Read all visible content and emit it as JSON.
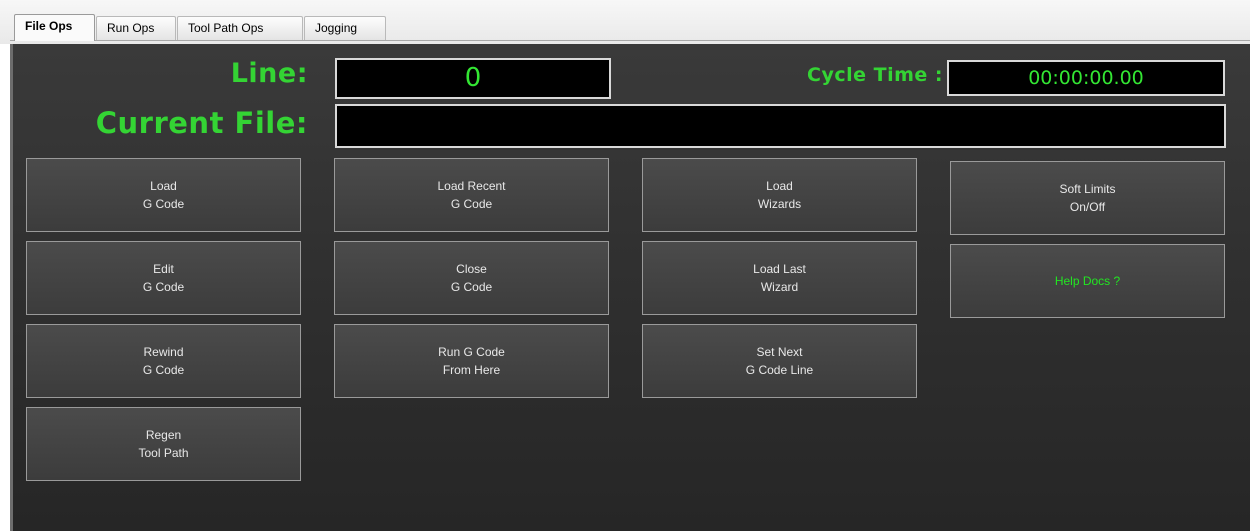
{
  "tabs": [
    {
      "label": "File Ops",
      "active": true
    },
    {
      "label": "Run Ops",
      "active": false
    },
    {
      "label": "Tool Path Ops",
      "active": false
    },
    {
      "label": "Jogging",
      "active": false
    }
  ],
  "header": {
    "line_label": "Line:",
    "line_value": "0",
    "cycle_time_label": "Cycle Time :",
    "cycle_time_value": "00:00:00.00",
    "current_file_label": "Current File:",
    "current_file_value": ""
  },
  "buttons": {
    "load_gcode": [
      "Load",
      "G Code"
    ],
    "load_recent": [
      "Load Recent",
      "G Code"
    ],
    "load_wizards": [
      "Load",
      "Wizards"
    ],
    "soft_limits": [
      "Soft Limits",
      "On/Off"
    ],
    "edit_gcode": [
      "Edit",
      "G Code"
    ],
    "close_gcode": [
      "Close",
      "G Code"
    ],
    "load_last_wizard": [
      "Load Last",
      "Wizard"
    ],
    "help_docs": [
      "Help Docs ?"
    ],
    "rewind_gcode": [
      "Rewind",
      "G Code"
    ],
    "run_from_here": [
      "Run G Code",
      "From Here"
    ],
    "set_next_line": [
      "Set Next",
      "G Code Line"
    ],
    "regen_toolpath": [
      "Regen",
      "Tool Path"
    ]
  },
  "colors": {
    "accent_green": "#34d434",
    "panel_bg": "#333333",
    "dro_bg": "#000000"
  }
}
